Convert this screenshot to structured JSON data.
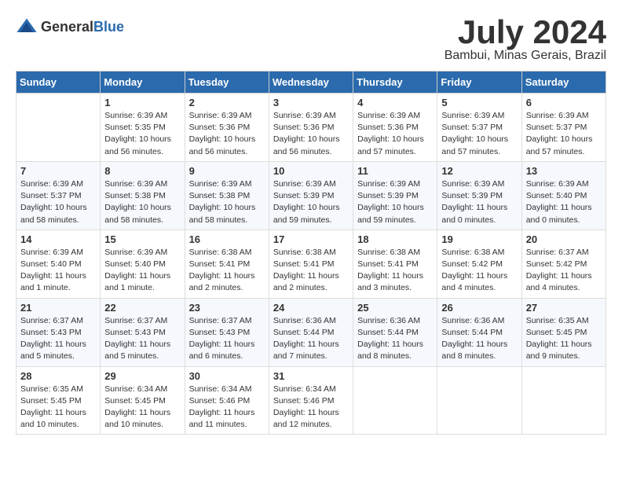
{
  "logo": {
    "general": "General",
    "blue": "Blue"
  },
  "title": {
    "month_year": "July 2024",
    "location": "Bambui, Minas Gerais, Brazil"
  },
  "headers": [
    "Sunday",
    "Monday",
    "Tuesday",
    "Wednesday",
    "Thursday",
    "Friday",
    "Saturday"
  ],
  "weeks": [
    [
      {
        "day": "",
        "info": ""
      },
      {
        "day": "1",
        "info": "Sunrise: 6:39 AM\nSunset: 5:35 PM\nDaylight: 10 hours\nand 56 minutes."
      },
      {
        "day": "2",
        "info": "Sunrise: 6:39 AM\nSunset: 5:36 PM\nDaylight: 10 hours\nand 56 minutes."
      },
      {
        "day": "3",
        "info": "Sunrise: 6:39 AM\nSunset: 5:36 PM\nDaylight: 10 hours\nand 56 minutes."
      },
      {
        "day": "4",
        "info": "Sunrise: 6:39 AM\nSunset: 5:36 PM\nDaylight: 10 hours\nand 57 minutes."
      },
      {
        "day": "5",
        "info": "Sunrise: 6:39 AM\nSunset: 5:37 PM\nDaylight: 10 hours\nand 57 minutes."
      },
      {
        "day": "6",
        "info": "Sunrise: 6:39 AM\nSunset: 5:37 PM\nDaylight: 10 hours\nand 57 minutes."
      }
    ],
    [
      {
        "day": "7",
        "info": "Sunrise: 6:39 AM\nSunset: 5:37 PM\nDaylight: 10 hours\nand 58 minutes."
      },
      {
        "day": "8",
        "info": "Sunrise: 6:39 AM\nSunset: 5:38 PM\nDaylight: 10 hours\nand 58 minutes."
      },
      {
        "day": "9",
        "info": "Sunrise: 6:39 AM\nSunset: 5:38 PM\nDaylight: 10 hours\nand 58 minutes."
      },
      {
        "day": "10",
        "info": "Sunrise: 6:39 AM\nSunset: 5:39 PM\nDaylight: 10 hours\nand 59 minutes."
      },
      {
        "day": "11",
        "info": "Sunrise: 6:39 AM\nSunset: 5:39 PM\nDaylight: 10 hours\nand 59 minutes."
      },
      {
        "day": "12",
        "info": "Sunrise: 6:39 AM\nSunset: 5:39 PM\nDaylight: 11 hours\nand 0 minutes."
      },
      {
        "day": "13",
        "info": "Sunrise: 6:39 AM\nSunset: 5:40 PM\nDaylight: 11 hours\nand 0 minutes."
      }
    ],
    [
      {
        "day": "14",
        "info": "Sunrise: 6:39 AM\nSunset: 5:40 PM\nDaylight: 11 hours\nand 1 minute."
      },
      {
        "day": "15",
        "info": "Sunrise: 6:39 AM\nSunset: 5:40 PM\nDaylight: 11 hours\nand 1 minute."
      },
      {
        "day": "16",
        "info": "Sunrise: 6:38 AM\nSunset: 5:41 PM\nDaylight: 11 hours\nand 2 minutes."
      },
      {
        "day": "17",
        "info": "Sunrise: 6:38 AM\nSunset: 5:41 PM\nDaylight: 11 hours\nand 2 minutes."
      },
      {
        "day": "18",
        "info": "Sunrise: 6:38 AM\nSunset: 5:41 PM\nDaylight: 11 hours\nand 3 minutes."
      },
      {
        "day": "19",
        "info": "Sunrise: 6:38 AM\nSunset: 5:42 PM\nDaylight: 11 hours\nand 4 minutes."
      },
      {
        "day": "20",
        "info": "Sunrise: 6:37 AM\nSunset: 5:42 PM\nDaylight: 11 hours\nand 4 minutes."
      }
    ],
    [
      {
        "day": "21",
        "info": "Sunrise: 6:37 AM\nSunset: 5:43 PM\nDaylight: 11 hours\nand 5 minutes."
      },
      {
        "day": "22",
        "info": "Sunrise: 6:37 AM\nSunset: 5:43 PM\nDaylight: 11 hours\nand 5 minutes."
      },
      {
        "day": "23",
        "info": "Sunrise: 6:37 AM\nSunset: 5:43 PM\nDaylight: 11 hours\nand 6 minutes."
      },
      {
        "day": "24",
        "info": "Sunrise: 6:36 AM\nSunset: 5:44 PM\nDaylight: 11 hours\nand 7 minutes."
      },
      {
        "day": "25",
        "info": "Sunrise: 6:36 AM\nSunset: 5:44 PM\nDaylight: 11 hours\nand 8 minutes."
      },
      {
        "day": "26",
        "info": "Sunrise: 6:36 AM\nSunset: 5:44 PM\nDaylight: 11 hours\nand 8 minutes."
      },
      {
        "day": "27",
        "info": "Sunrise: 6:35 AM\nSunset: 5:45 PM\nDaylight: 11 hours\nand 9 minutes."
      }
    ],
    [
      {
        "day": "28",
        "info": "Sunrise: 6:35 AM\nSunset: 5:45 PM\nDaylight: 11 hours\nand 10 minutes."
      },
      {
        "day": "29",
        "info": "Sunrise: 6:34 AM\nSunset: 5:45 PM\nDaylight: 11 hours\nand 10 minutes."
      },
      {
        "day": "30",
        "info": "Sunrise: 6:34 AM\nSunset: 5:46 PM\nDaylight: 11 hours\nand 11 minutes."
      },
      {
        "day": "31",
        "info": "Sunrise: 6:34 AM\nSunset: 5:46 PM\nDaylight: 11 hours\nand 12 minutes."
      },
      {
        "day": "",
        "info": ""
      },
      {
        "day": "",
        "info": ""
      },
      {
        "day": "",
        "info": ""
      }
    ]
  ]
}
